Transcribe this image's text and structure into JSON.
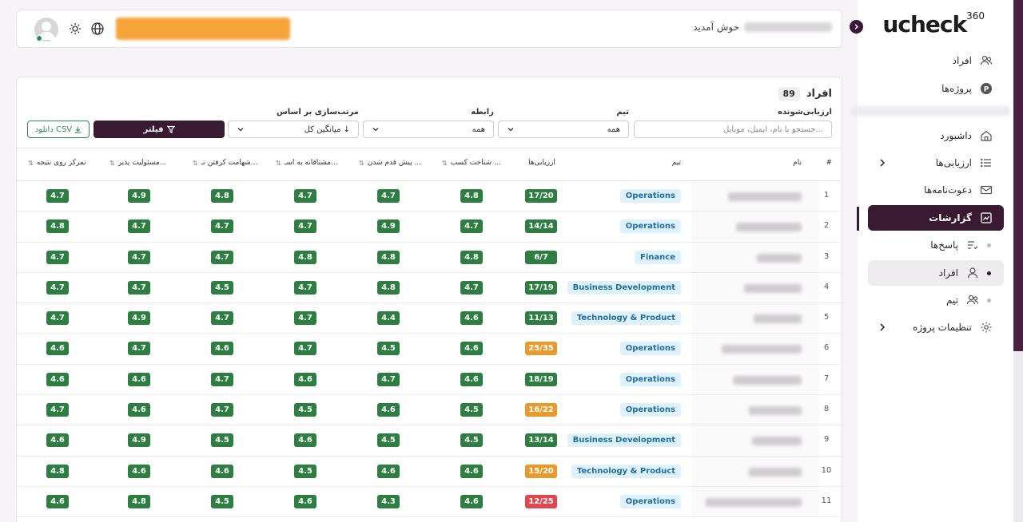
{
  "brand": {
    "logo": "ucheck",
    "logo_sup": "360"
  },
  "sidebar": {
    "items": [
      {
        "label": "افراد",
        "icon": "users-icon"
      },
      {
        "label": "پروژه‌ها",
        "icon": "project-p-icon"
      },
      {
        "label": "داشبورد",
        "icon": "home-icon"
      },
      {
        "label": "ارزیابی‌ها",
        "icon": "list-icon"
      },
      {
        "label": "دعوت‌نامه‌ها",
        "icon": "mail-icon"
      },
      {
        "label": "گزارشات",
        "icon": "chart-icon"
      },
      {
        "label": "پاسخ‌ها",
        "icon": "answers-icon"
      },
      {
        "label": "افراد",
        "icon": "person-icon"
      },
      {
        "label": "تیم",
        "icon": "team-icon"
      },
      {
        "label": "تنظیمات پروژه",
        "icon": "gear-icon"
      }
    ]
  },
  "header": {
    "welcome": "خوش آمدید"
  },
  "panel": {
    "title": "افراد",
    "count": "89",
    "filters": {
      "evaluatee_label": "ارزیابی‌شونده",
      "search_placeholder": "جستجو با نام، ایمیل، موبایل...",
      "team_label": "تیم",
      "team_value": "همه",
      "relation_label": "رابطه",
      "relation_value": "همه",
      "sort_label": "مرتب‌سازی بر اساس",
      "sort_value": "میانگین کل ↓",
      "filter_button": "فیلتر",
      "csv_button": "دانلود CSV"
    },
    "columns": {
      "num": "#",
      "name": "نام",
      "team": "تیم",
      "evals": "ارزیابی‌ها",
      "c1": "شناخت کسب ...",
      "c2": "پیش قدم شدن ...",
      "c3": "مشتاقانه یه اسـ...",
      "c4": "شهامت کرفتن تـ...",
      "c5": "مسئولیت پذیر...",
      "c6": "تمرکز روی نتیجه"
    },
    "rows": [
      {
        "n": "1",
        "team": "Operations",
        "evals": "17/20",
        "eval_color": "#2e7d42",
        "s": [
          "4.8",
          "4.7",
          "4.7",
          "4.8",
          "4.9",
          "4.7"
        ]
      },
      {
        "n": "2",
        "team": "Operations",
        "evals": "14/14",
        "eval_color": "#2e7d42",
        "s": [
          "4.7",
          "4.9",
          "4.7",
          "4.7",
          "4.7",
          "4.8"
        ]
      },
      {
        "n": "3",
        "team": "Finance",
        "evals": "6/7",
        "eval_color": "#2e7d42",
        "s": [
          "4.8",
          "4.8",
          "4.8",
          "4.7",
          "4.7",
          "4.7"
        ]
      },
      {
        "n": "4",
        "team": "Business Development",
        "evals": "17/19",
        "eval_color": "#2e7d42",
        "s": [
          "4.7",
          "4.8",
          "4.7",
          "4.5",
          "4.7",
          "4.7"
        ]
      },
      {
        "n": "5",
        "team": "Technology & Product",
        "evals": "11/13",
        "eval_color": "#2e7d42",
        "s": [
          "4.6",
          "4.4",
          "4.7",
          "4.7",
          "4.9",
          "4.7"
        ]
      },
      {
        "n": "6",
        "team": "Operations",
        "evals": "25/35",
        "eval_color": "#e89a2c",
        "s": [
          "4.6",
          "4.5",
          "4.7",
          "4.6",
          "4.7",
          "4.6"
        ]
      },
      {
        "n": "7",
        "team": "Operations",
        "evals": "18/19",
        "eval_color": "#2e7d42",
        "s": [
          "4.6",
          "4.7",
          "4.6",
          "4.7",
          "4.6",
          "4.6"
        ]
      },
      {
        "n": "8",
        "team": "Operations",
        "evals": "16/22",
        "eval_color": "#e89a2c",
        "s": [
          "4.5",
          "4.6",
          "4.5",
          "4.7",
          "4.6",
          "4.7"
        ]
      },
      {
        "n": "9",
        "team": "Business Development",
        "evals": "13/14",
        "eval_color": "#2e7d42",
        "s": [
          "4.5",
          "4.5",
          "4.6",
          "4.5",
          "4.9",
          "4.6"
        ]
      },
      {
        "n": "10",
        "team": "Technology & Product",
        "evals": "15/20",
        "eval_color": "#e89a2c",
        "s": [
          "4.6",
          "4.6",
          "4.5",
          "4.6",
          "4.6",
          "4.8"
        ]
      },
      {
        "n": "11",
        "team": "Operations",
        "evals": "12/25",
        "eval_color": "#e0464e",
        "s": [
          "4.6",
          "4.3",
          "4.6",
          "4.5",
          "4.8",
          "4.6"
        ]
      }
    ]
  }
}
